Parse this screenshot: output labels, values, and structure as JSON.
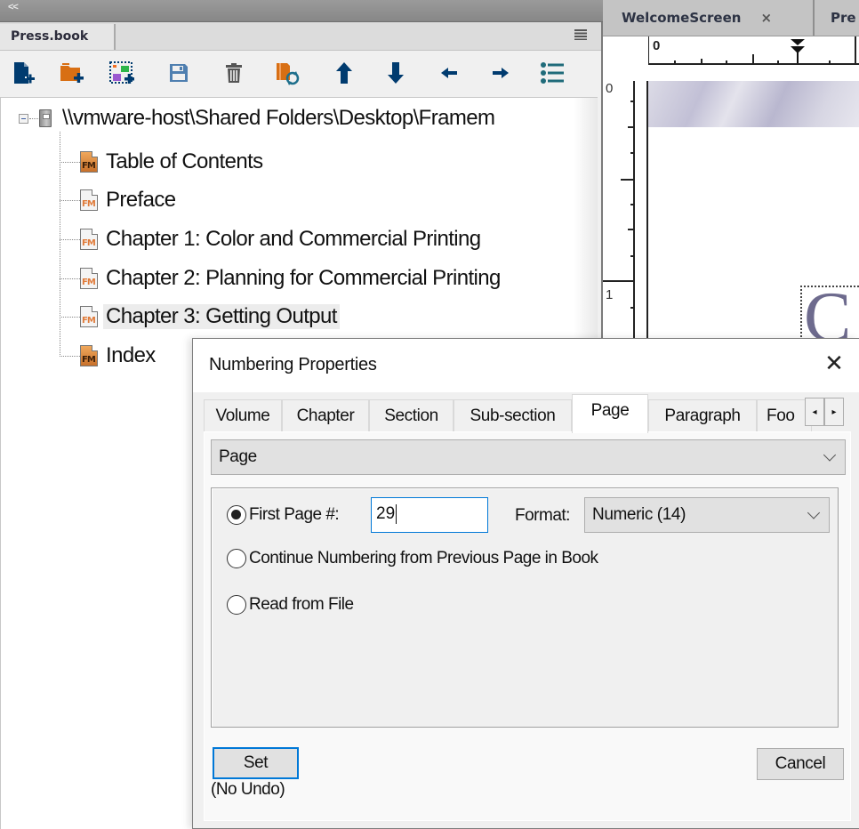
{
  "collapse_bar": {
    "chevron": "<<"
  },
  "book_panel": {
    "tab_label": "Press.book",
    "menu_icon": "hamburger-menu-icon",
    "toolbar": [
      {
        "name": "add-file",
        "icon": "add-file-icon",
        "color": "#003b6f"
      },
      {
        "name": "add-folder",
        "icon": "add-folder-icon",
        "color": "#d86f14"
      },
      {
        "name": "add-group",
        "icon": "add-group-icon",
        "color": "#003b6f"
      },
      {
        "name": "save",
        "icon": "save-icon",
        "color": "#4f7fb0"
      },
      {
        "name": "delete",
        "icon": "trash-icon",
        "color": "#555555"
      },
      {
        "name": "update-book",
        "icon": "update-book-icon",
        "color": "#d86f14"
      },
      {
        "name": "move-up",
        "icon": "arrow-up-icon",
        "color": "#003b6f"
      },
      {
        "name": "move-down",
        "icon": "arrow-down-icon",
        "color": "#003b6f"
      },
      {
        "name": "promote",
        "icon": "arrow-left-icon",
        "color": "#003b6f"
      },
      {
        "name": "demote",
        "icon": "arrow-right-icon",
        "color": "#003b6f"
      },
      {
        "name": "toc",
        "icon": "list-icon",
        "color": "#1f6b7a"
      }
    ],
    "tree": {
      "root_path": "\\\\vmware-host\\Shared Folders\\Desktop\\Framem",
      "items": [
        {
          "label": "Table of Contents",
          "generated": true
        },
        {
          "label": "Preface",
          "generated": false
        },
        {
          "label": "Chapter 1: Color and Commercial Printing",
          "generated": false
        },
        {
          "label": "Chapter 2: Planning for Commercial Printing",
          "generated": false
        },
        {
          "label": "Chapter 3: Getting Output",
          "generated": false,
          "selected": true
        },
        {
          "label": "Index",
          "generated": true
        }
      ],
      "file_icon_label": "FM"
    }
  },
  "document": {
    "tabs": [
      {
        "label": "WelcomeScreen",
        "close": "×"
      },
      {
        "label": "Pre"
      }
    ],
    "ruler_h_zero": "0",
    "ruler_v_labels": [
      "0",
      "1"
    ],
    "page_glyph": "C"
  },
  "dialog": {
    "title": "Numbering Properties",
    "close": "✕",
    "tabs": [
      "Volume",
      "Chapter",
      "Section",
      "Sub-section",
      "Page",
      "Paragraph",
      "Foo"
    ],
    "active_tab": "Page",
    "tab_scroll_left": "◂",
    "tab_scroll_right": "▸",
    "category_select": "Page",
    "options": {
      "first_page": {
        "label": "First Page #:",
        "checked": true,
        "value": "29"
      },
      "continue": {
        "label": "Continue Numbering from Previous Page in Book",
        "checked": false
      },
      "read_from_file": {
        "label": "Read from File",
        "checked": false
      }
    },
    "format_label": "Format:",
    "format_value": "Numeric  (14)",
    "set_button": "Set",
    "no_undo": "(No Undo)",
    "cancel_button": "Cancel"
  }
}
